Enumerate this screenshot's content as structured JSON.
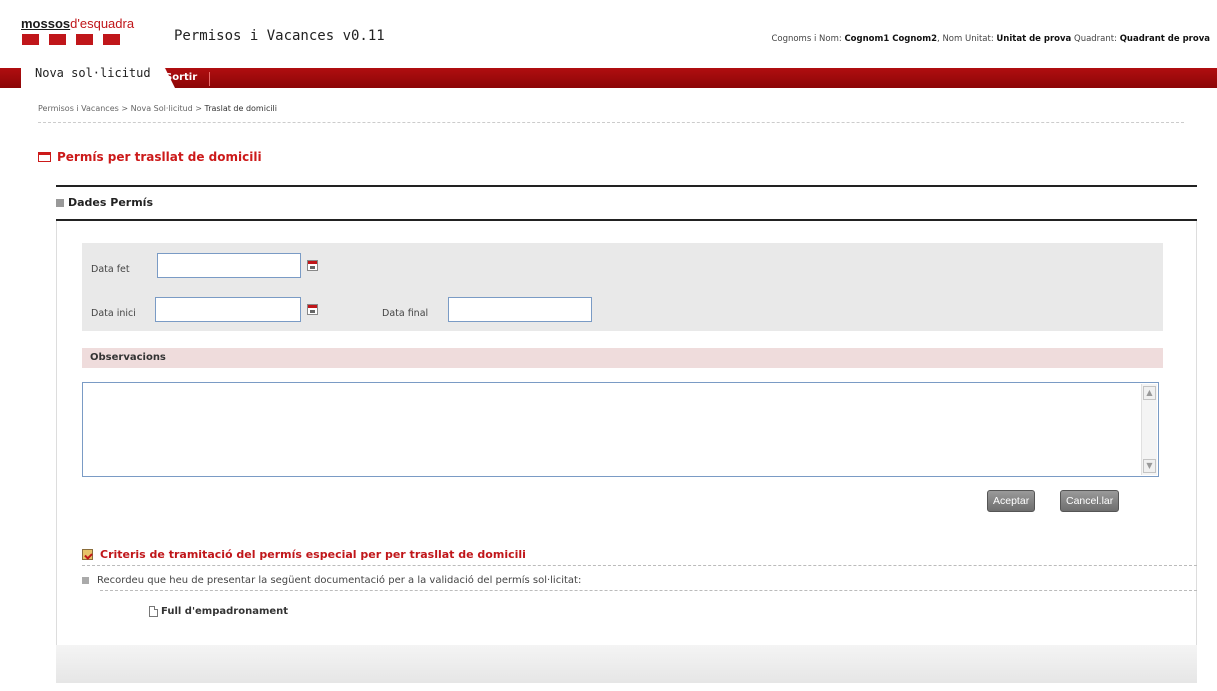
{
  "header": {
    "logo_brand": "mossos",
    "logo_suffix": "d'esquadra",
    "app_title": "Permisos i Vacances v0.11",
    "user": {
      "name_label": "Cognoms i Nom:",
      "name_value": "Cognom1 Cognom2",
      "unit_label": "Nom Unitat:",
      "unit_value": "Unitat de prova",
      "quadrant_label": "Quadrant:",
      "quadrant_value": "Quadrant de prova"
    }
  },
  "nav": {
    "active_tab": "Nova sol·licitud",
    "exit_link": "Sortir"
  },
  "breadcrumb": {
    "items": [
      "Permisos i Vacances",
      "Nova Sol·licitud"
    ],
    "separator": ">",
    "current": "Traslat de domicili"
  },
  "page_title": "Permís per trasllat de domicili",
  "section_title": "Dades Permís",
  "form": {
    "data_fet_label": "Data fet",
    "data_fet_value": "",
    "data_inici_label": "Data inici",
    "data_inici_value": "",
    "data_final_label": "Data final",
    "data_final_value": "",
    "observacions_label": "Observacions",
    "observacions_value": ""
  },
  "buttons": {
    "accept": "Aceptar",
    "cancel": "Cancel.lar"
  },
  "criteria": {
    "title": "Criteris de tramitació del permís especial per per trasllat de domicili",
    "note": "Recordeu que heu de presentar la següent documentació per a la validació del permís sol·licitat:",
    "documents": [
      "Full d'empadronament"
    ]
  },
  "colors": {
    "brand_red": "#c0161a",
    "nav_red": "#a00a0c",
    "input_border": "#7a9bc5"
  }
}
